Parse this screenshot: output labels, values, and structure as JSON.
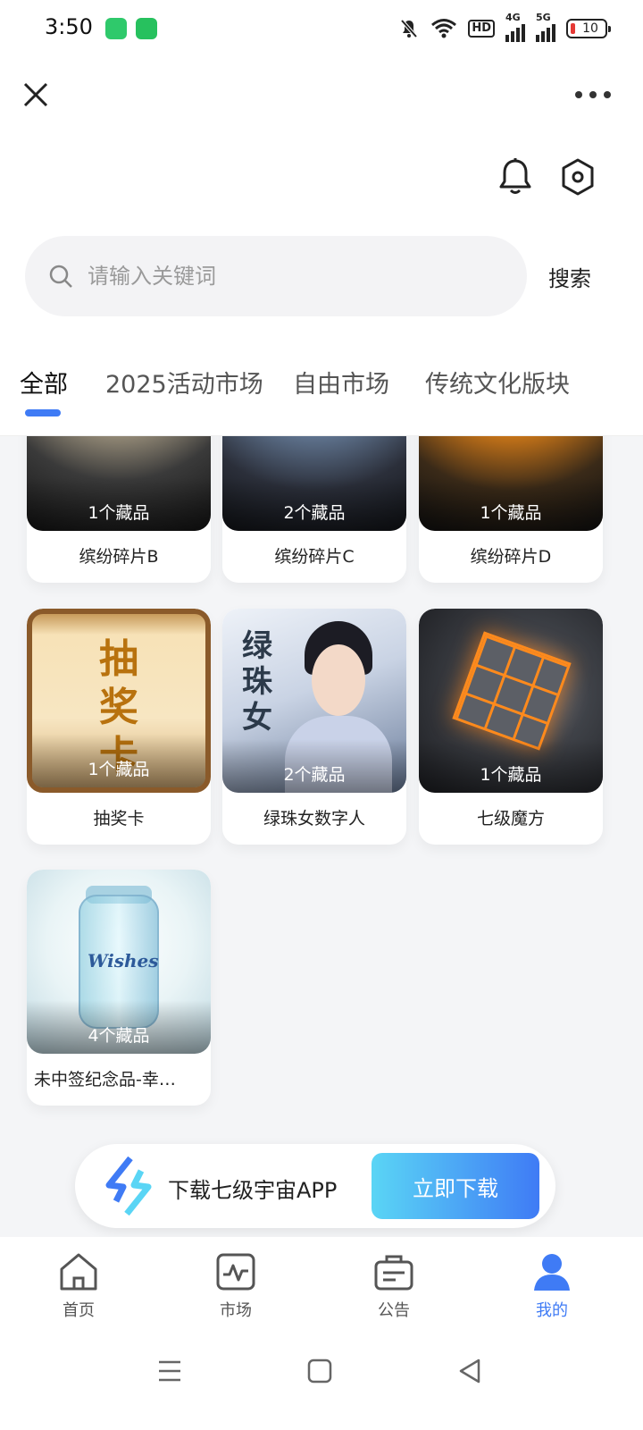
{
  "status_bar": {
    "time": "3:50",
    "battery": "10",
    "hd": "HD",
    "net1": "4G",
    "net2": "5G"
  },
  "search": {
    "placeholder": "请输入关键词",
    "button": "搜索"
  },
  "tabs": [
    {
      "label": "全部",
      "active": true
    },
    {
      "label": "2025活动市场"
    },
    {
      "label": "自由市场"
    },
    {
      "label": "传统文化版块"
    }
  ],
  "cards": [
    {
      "name": "缤纷碎片B",
      "count": "1个藏品",
      "image": "white-flower"
    },
    {
      "name": "缤纷碎片C",
      "count": "2个藏品",
      "image": "blue-flower"
    },
    {
      "name": "缤纷碎片D",
      "count": "1个藏品",
      "image": "orange-flower"
    },
    {
      "name": "抽奖卡",
      "count": "1个藏品",
      "image": "lottery-card",
      "art_text": "抽奖卡"
    },
    {
      "name": "绿珠女数字人",
      "count": "2个藏品",
      "image": "girl-portrait",
      "art_text": "绿珠女"
    },
    {
      "name": "七级魔方",
      "count": "1个藏品",
      "image": "glowing-cube"
    },
    {
      "name": "未中签纪念品-幸…",
      "count": "4个藏品",
      "image": "wish-jar",
      "art_text": "Wishes"
    }
  ],
  "banner": {
    "text": "下载七级宇宙APP",
    "button": "立即下载"
  },
  "bottom_nav": [
    {
      "label": "首页",
      "icon": "home-icon"
    },
    {
      "label": "市场",
      "icon": "market-chart-icon"
    },
    {
      "label": "公告",
      "icon": "announcement-icon"
    },
    {
      "label": "我的",
      "icon": "user-icon",
      "active": true
    }
  ],
  "colors": {
    "accent": "#3f7bf5",
    "banner_gradient_start": "#5ad5f5"
  }
}
